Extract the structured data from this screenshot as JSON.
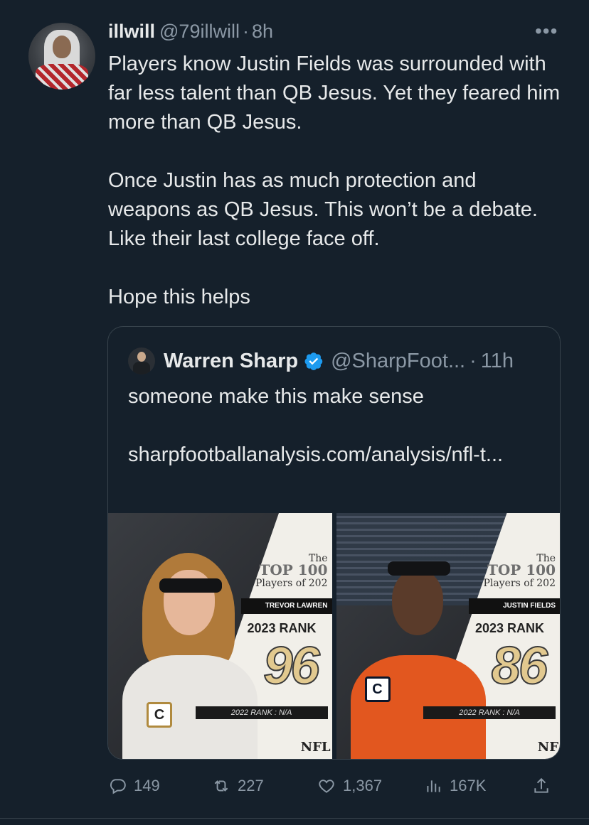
{
  "tweet": {
    "author_name": "illwill",
    "author_handle": "@79illwill",
    "separator": "·",
    "time": "8h",
    "more_label": "•••",
    "text_lines": [
      "Players know Justin Fields was surrounded with far less talent than QB Jesus.  Yet they feared him more than QB Jesus.",
      "Once Justin has as much protection and weapons as QB Jesus.  This won’t be a debate.  Like their last college face off.",
      "Hope this helps"
    ]
  },
  "quote": {
    "author_name": "Warren Sharp",
    "author_handle": "@SharpFoot...",
    "separator": "·",
    "time": "11h",
    "text": "someone make this make sense",
    "link": "sharpfootballanalysis.com/analysis/nfl-t...",
    "images": [
      {
        "logo_the": "The",
        "logo_top": "TOP 100",
        "logo_sub": "Players of 202",
        "player": "TREVOR LAWREN",
        "rank_label": "2023 RANK",
        "rank": "96",
        "prev_rank": "2022 RANK : N/A",
        "brand": "NFL",
        "patch": "C"
      },
      {
        "logo_the": "The",
        "logo_top": "TOP 100",
        "logo_sub": "Players of 202",
        "player": "JUSTIN FIELDS",
        "rank_label": "2023 RANK",
        "rank": "86",
        "prev_rank": "2022 RANK : N/A",
        "brand": "NF",
        "patch": "C"
      }
    ]
  },
  "actions": {
    "reply_count": "149",
    "retweet_count": "227",
    "like_count": "1,367",
    "view_count": "167K",
    "icons": [
      "reply-icon",
      "retweet-icon",
      "like-icon",
      "views-icon",
      "share-icon"
    ]
  },
  "colors": {
    "background": "#15202b",
    "text": "#e7e9ea",
    "muted": "#8b98a5",
    "border": "#38444d",
    "verified": "#1d9bf0"
  }
}
